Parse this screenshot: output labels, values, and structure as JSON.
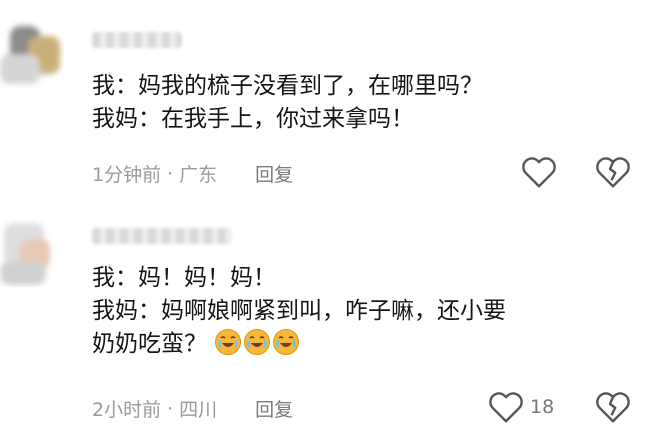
{
  "comments": [
    {
      "lines": [
        "我：妈我的梳子没看到了，在哪里吗？",
        "我妈：在我手上，你过来拿吗！"
      ],
      "time": "1分钟前",
      "location": "广东",
      "reply_label": "回复",
      "like_icon": "heart-icon",
      "dislike_icon": "broken-heart-icon"
    },
    {
      "lines": [
        "我：妈！妈！妈！",
        "我妈：妈啊娘啊紧到叫，咋子嘛，还小要",
        "奶奶吃蛮？"
      ],
      "emojis": [
        "crying-laughing-emoji",
        "crying-laughing-emoji",
        "crying-laughing-emoji"
      ],
      "time": "2小时前",
      "location": "四川",
      "reply_label": "回复",
      "like_count": "18",
      "like_icon": "heart-icon",
      "dislike_icon": "broken-heart-icon"
    }
  ],
  "colors": {
    "text": "#151515",
    "meta": "#9a9a9a",
    "icon": "#555555",
    "emoji": "#f5b83a"
  }
}
